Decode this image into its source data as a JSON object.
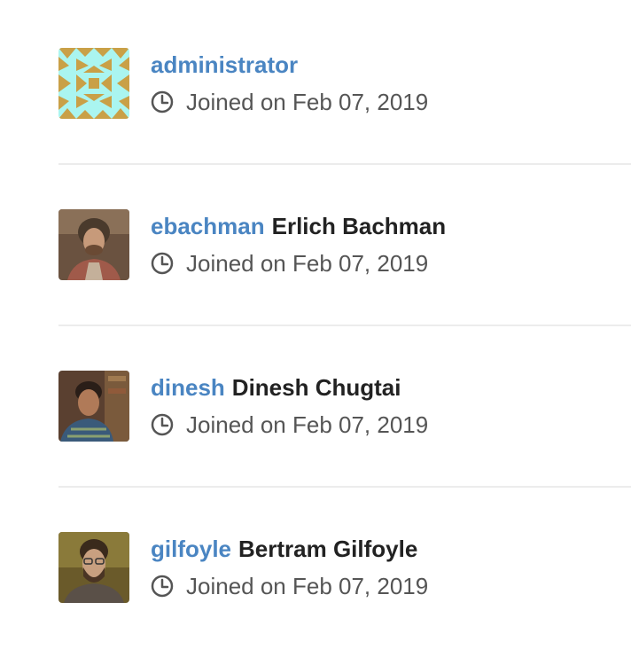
{
  "users": [
    {
      "username": "administrator",
      "full_name": "",
      "joined": "Joined on Feb 07, 2019",
      "avatar": "identicon"
    },
    {
      "username": "ebachman",
      "full_name": "Erlich Bachman",
      "joined": "Joined on Feb 07, 2019",
      "avatar": "photo"
    },
    {
      "username": "dinesh",
      "full_name": "Dinesh Chugtai",
      "joined": "Joined on Feb 07, 2019",
      "avatar": "photo"
    },
    {
      "username": "gilfoyle",
      "full_name": "Bertram Gilfoyle",
      "joined": "Joined on Feb 07, 2019",
      "avatar": "photo"
    }
  ],
  "colors": {
    "username_link": "#4a85c2",
    "full_name": "#222222",
    "meta_text": "#555555",
    "divider": "#ececec",
    "identicon_bg": "#aaf5f0",
    "identicon_fg": "#c9a047"
  }
}
